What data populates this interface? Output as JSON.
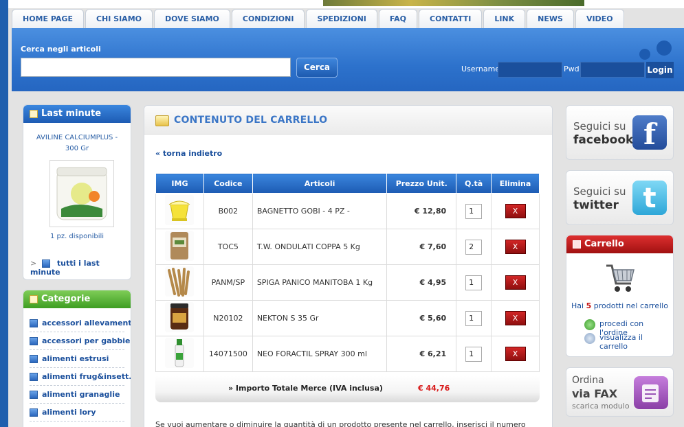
{
  "nav": {
    "tabs": [
      "HOME PAGE",
      "CHI SIAMO",
      "DOVE SIAMO",
      "CONDIZIONI",
      "SPEDIZIONI",
      "FAQ",
      "CONTATTI",
      "LINK",
      "NEWS",
      "VIDEO"
    ]
  },
  "header": {
    "search_label": "Cerca negli articoli",
    "search_button": "Cerca",
    "username_label": "Username",
    "pwd_label": "Pwd",
    "login_button": "Login"
  },
  "last_minute": {
    "title": "Last minute",
    "product_name": "AVILINE CALCIUMPLUS - 300 Gr",
    "availability": "1 pz. disponibili",
    "all_link": "tutti i last minute"
  },
  "categorie": {
    "title": "Categorie",
    "items": [
      "accessori allevamenti",
      "accessori per gabbie",
      "alimenti estrusi",
      "alimenti frug&insett.",
      "alimenti granaglie",
      "alimenti lory"
    ]
  },
  "cart_page": {
    "title": "CONTENUTO DEL CARRELLO",
    "back_link": "« torna indietro",
    "columns": [
      "IMG",
      "Codice",
      "Articoli",
      "Prezzo Unit.",
      "Q.tà",
      "Elimina"
    ],
    "rows": [
      {
        "code": "B002",
        "article": "BAGNETTO GOBI - 4 PZ -",
        "price": "€ 12,80",
        "qty": "1",
        "delete": "X"
      },
      {
        "code": "TOC5",
        "article": "T.W. ONDULATI COPPA 5 Kg",
        "price": "€ 7,60",
        "qty": "2",
        "delete": "X"
      },
      {
        "code": "PANM/SP",
        "article": "SPIGA PANICO MANITOBA 1 Kg",
        "price": "€ 4,95",
        "qty": "1",
        "delete": "X"
      },
      {
        "code": "N20102",
        "article": "NEKTON S 35 Gr",
        "price": "€ 5,60",
        "qty": "1",
        "delete": "X"
      },
      {
        "code": "14071500",
        "article": "NEO FORACTIL SPRAY 300 ml",
        "price": "€ 6,21",
        "qty": "1",
        "delete": "X"
      }
    ],
    "total_label": "» Importo Totale Merce (IVA inclusa)",
    "total_value": "€ 44,76",
    "info_text": "Se vuoi aumentare o diminuire la quantità di un prodotto presente nel carrello, inserisci il numero"
  },
  "social": {
    "facebook_line1": "Seguici su",
    "facebook_line2": "facebook",
    "twitter_line1": "Seguici su",
    "twitter_line2": "twitter"
  },
  "cart_box": {
    "title": "Carrello",
    "summary_prefix": "Hai",
    "summary_count": "5",
    "summary_suffix": "prodotti nel carrello",
    "proceed_link": "procedi con l'ordine",
    "view_link": "visualizza il carrello"
  },
  "fax": {
    "line1": "Ordina",
    "line2": "via FAX",
    "sub": "scarica modulo"
  }
}
